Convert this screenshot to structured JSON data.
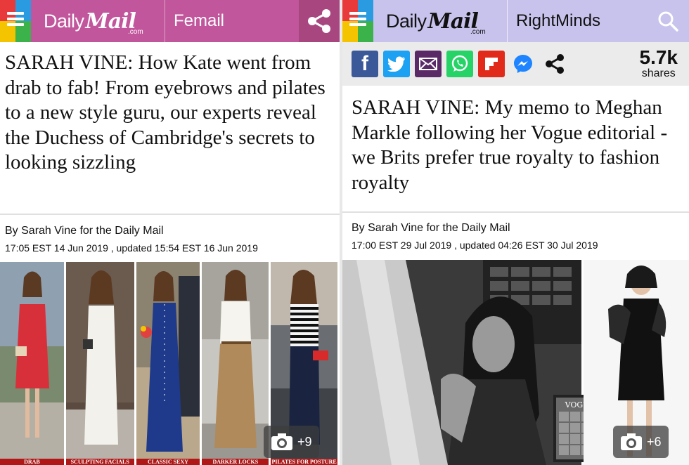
{
  "left": {
    "header": {
      "logo_daily": "Daily",
      "logo_mail": "Mail",
      "logo_com": ".com",
      "section": "Femail",
      "accent": "#c2569c"
    },
    "headline": "SARAH VINE: How Kate went from drab to fab! From eyebrows and pilates to a new style guru, our experts reveal the Duchess of Cambridge's secrets to looking sizzling",
    "byline": "By Sarah Vine for the Daily Mail",
    "dateline": "17:05 EST 14 Jun 2019 , updated 15:54 EST 16 Jun 2019",
    "gallery": {
      "captions": [
        "DRAB",
        "SCULPTING FACIALS",
        "CLASSIC SEXY",
        "DARKER LOCKS",
        "PILATES FOR POSTURE"
      ],
      "count": "+9"
    }
  },
  "right": {
    "header": {
      "logo_daily": "Daily",
      "logo_mail": "Mail",
      "logo_com": ".com",
      "section": "RightMinds",
      "accent": "#c8c3ec"
    },
    "social": {
      "buttons": [
        "facebook-icon",
        "twitter-icon",
        "email-icon",
        "whatsapp-icon",
        "flipboard-icon",
        "messenger-icon",
        "share-icon"
      ],
      "shares_count": "5.7k",
      "shares_label": "shares"
    },
    "headline": "SARAH VINE: My memo to Meghan Markle following her Vogue editorial - we Brits prefer true royalty to fashion royalty",
    "byline": "By Sarah Vine for the Daily Mail",
    "dateline": "17:00 EST 29 Jul 2019 , updated 04:26 EST 30 Jul 2019",
    "gallery": {
      "count": "+6"
    }
  }
}
